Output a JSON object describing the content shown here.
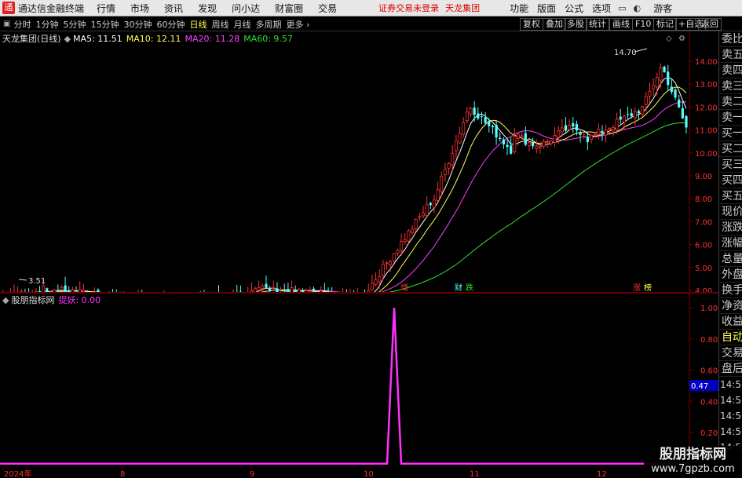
{
  "menubar": {
    "app_title": "通达信金融终端",
    "menus": [
      "行情",
      "市场",
      "资讯",
      "发现",
      "问小达",
      "财富圈",
      "交易"
    ],
    "notice": "证券交易未登录",
    "stock_name": "天龙集团",
    "right_menus": [
      "功能",
      "版面",
      "公式",
      "选项"
    ],
    "guest": "游客"
  },
  "toolbar": {
    "periods": [
      "分时",
      "1分钟",
      "5分钟",
      "15分钟",
      "30分钟",
      "60分钟",
      "日线",
      "周线",
      "月线",
      "多周期",
      "更多"
    ],
    "active_period": "日线",
    "right_buttons": [
      "复权",
      "叠加",
      "多股",
      "统计",
      "画线",
      "F10",
      "标记",
      "+自选",
      "返回"
    ]
  },
  "legend": {
    "stock": "天龙集团(日线)",
    "ma5": "MA5: 11.51",
    "ma10": "MA10: 12.11",
    "ma20": "MA20: 11.28",
    "ma60": "MA60: 9.57"
  },
  "colors": {
    "ma5": "#ffffff",
    "ma10": "#ffff55",
    "ma20": "#ff40ff",
    "ma60": "#30e030",
    "up": "#ff3030",
    "down": "#54ffff",
    "axis_text": "#ff3030",
    "signal": "#ff30ff"
  },
  "chart_labels": {
    "high": "14.70",
    "low": "3.51",
    "events": [
      "增",
      "财",
      "跌",
      "涨",
      "榜"
    ]
  },
  "price_axis": [
    "14.00",
    "13.00",
    "12.00",
    "11.00",
    "10.00",
    "9.00",
    "8.00",
    "7.00",
    "6.00",
    "5.00",
    "4.00"
  ],
  "sidebar": {
    "items": [
      "委比",
      "卖五",
      "卖四",
      "卖三",
      "卖二",
      "卖一",
      "买一",
      "买二",
      "买三",
      "买四",
      "买五",
      "现价",
      "涨跌",
      "涨幅",
      "总量",
      "外盘",
      "换手",
      "净资",
      "收益",
      "自动",
      "交易",
      "盘后"
    ],
    "active": "自动",
    "timestamps": [
      "14:56",
      "14:56",
      "14:56",
      "14:56",
      "14:56",
      "14:56",
      "14:56",
      "14:56",
      "14:57"
    ]
  },
  "sub_panel": {
    "name": "股朋指标网",
    "value_label": "捉妖: 0.00",
    "axis": [
      "1.00",
      "0.80",
      "0.60",
      "0.40",
      "0.20"
    ],
    "cursor_value": "0.47"
  },
  "date_axis": [
    "2024年",
    "8",
    "9",
    "10",
    "11",
    "12"
  ],
  "watermark": {
    "title": "股朋指标网",
    "url": "www.7gpzb.com"
  },
  "icons": {
    "diamond": "◇",
    "gear": "⚙",
    "dropdown": "▼"
  }
}
